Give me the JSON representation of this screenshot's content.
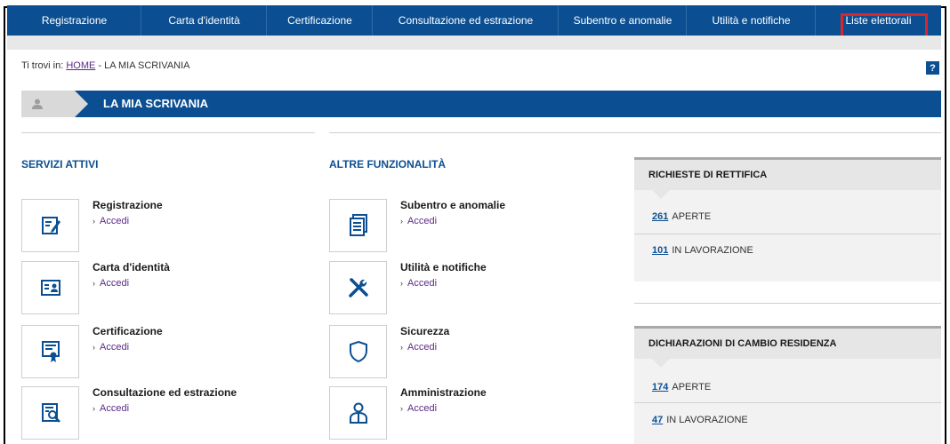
{
  "nav": {
    "items": [
      {
        "label": "Registrazione"
      },
      {
        "label": "Carta d'identità"
      },
      {
        "label": "Certificazione"
      },
      {
        "label": "Consultazione ed estrazione"
      },
      {
        "label": "Subentro e anomalie"
      },
      {
        "label": "Utilità e notifiche"
      },
      {
        "label": "Liste elettorali"
      }
    ],
    "highlight_color": "#d9262d"
  },
  "breadcrumb": {
    "prefix": "Ti trovi in: ",
    "home": "HOME",
    "separator": " - ",
    "current": "LA MIA SCRIVANIA"
  },
  "help_label": "?",
  "page_title": "LA MIA SCRIVANIA",
  "servizi_attivi": {
    "title": "SERVIZI ATTIVI",
    "items": [
      {
        "name": "Registrazione",
        "link": "Accedi",
        "icon": "edit-form-icon"
      },
      {
        "name": "Carta d'identità",
        "link": "Accedi",
        "icon": "id-card-icon"
      },
      {
        "name": "Certificazione",
        "link": "Accedi",
        "icon": "certificate-icon"
      },
      {
        "name": "Consultazione ed estrazione",
        "link": "Accedi",
        "icon": "document-search-icon"
      }
    ]
  },
  "altre_funzionalita": {
    "title": "ALTRE FUNZIONALITÀ",
    "items": [
      {
        "name": "Subentro e anomalie",
        "link": "Accedi",
        "icon": "documents-icon"
      },
      {
        "name": "Utilità e notifiche",
        "link": "Accedi",
        "icon": "tools-icon"
      },
      {
        "name": "Sicurezza",
        "link": "Accedi",
        "icon": "shield-icon"
      },
      {
        "name": "Amministrazione",
        "link": "Accedi",
        "icon": "admin-user-icon"
      }
    ]
  },
  "richieste": {
    "title": "RICHIESTE DI RETTIFICA",
    "rows": [
      {
        "count": "261",
        "label": "APERTE"
      },
      {
        "count": "101",
        "label": "IN LAVORAZIONE"
      }
    ]
  },
  "dichiarazioni": {
    "title": "DICHIARAZIONI DI CAMBIO RESIDENZA",
    "rows": [
      {
        "count": "174",
        "label": "APERTE"
      },
      {
        "count": "47",
        "label": "IN LAVORAZIONE"
      }
    ]
  },
  "colors": {
    "primary": "#0b4f92",
    "link": "#5b2a86",
    "panel_bg": "#f2f2f2"
  }
}
